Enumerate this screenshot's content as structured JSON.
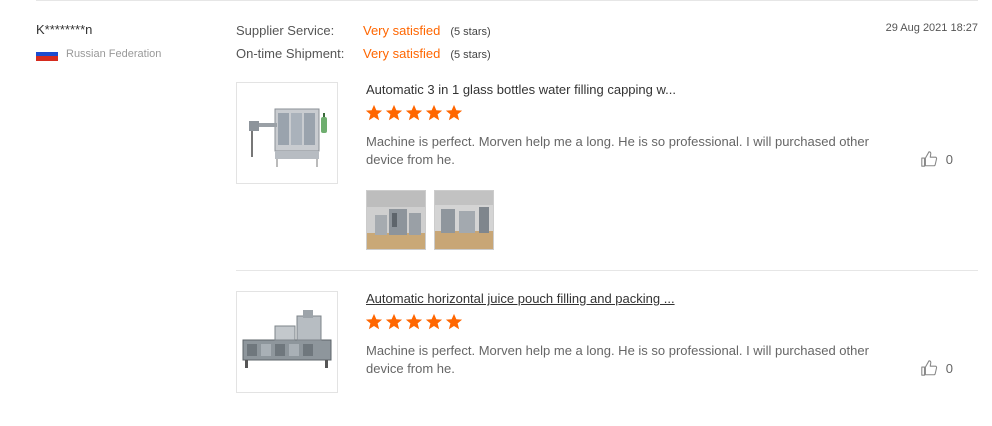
{
  "buyer": {
    "name": "K********n",
    "country": "Russian Federation",
    "flag_icon": "russia-flag-icon",
    "flag_colors": [
      "#ffffff",
      "#1c4ccf",
      "#d52b1e"
    ]
  },
  "ratings": [
    {
      "label": "Supplier Service:",
      "value": "Very satisfied",
      "stars": "(5 stars)"
    },
    {
      "label": "On-time Shipment:",
      "value": "Very satisfied",
      "stars": "(5 stars)"
    }
  ],
  "date": "29 Aug 2021 18:27",
  "colors": {
    "accent": "#ff6600",
    "star": "#ff6600",
    "text": "#333333",
    "muted": "#999999"
  },
  "reviews": [
    {
      "product_title": "Automatic 3 in 1 glass bottles water filling capping w...",
      "rating": 5,
      "comment": "Machine is perfect. Morven help me a long. He is so professional. I will purchased other device from he.",
      "likes": "0",
      "photos": [
        "factory-photo-1",
        "factory-photo-2"
      ]
    },
    {
      "product_title": "Automatic horizontal juice pouch filling and packing ...",
      "rating": 5,
      "comment": "Machine is perfect. Morven help me a long. He is so professional. I will purchased other device from he.",
      "likes": "0",
      "photos": []
    }
  ]
}
